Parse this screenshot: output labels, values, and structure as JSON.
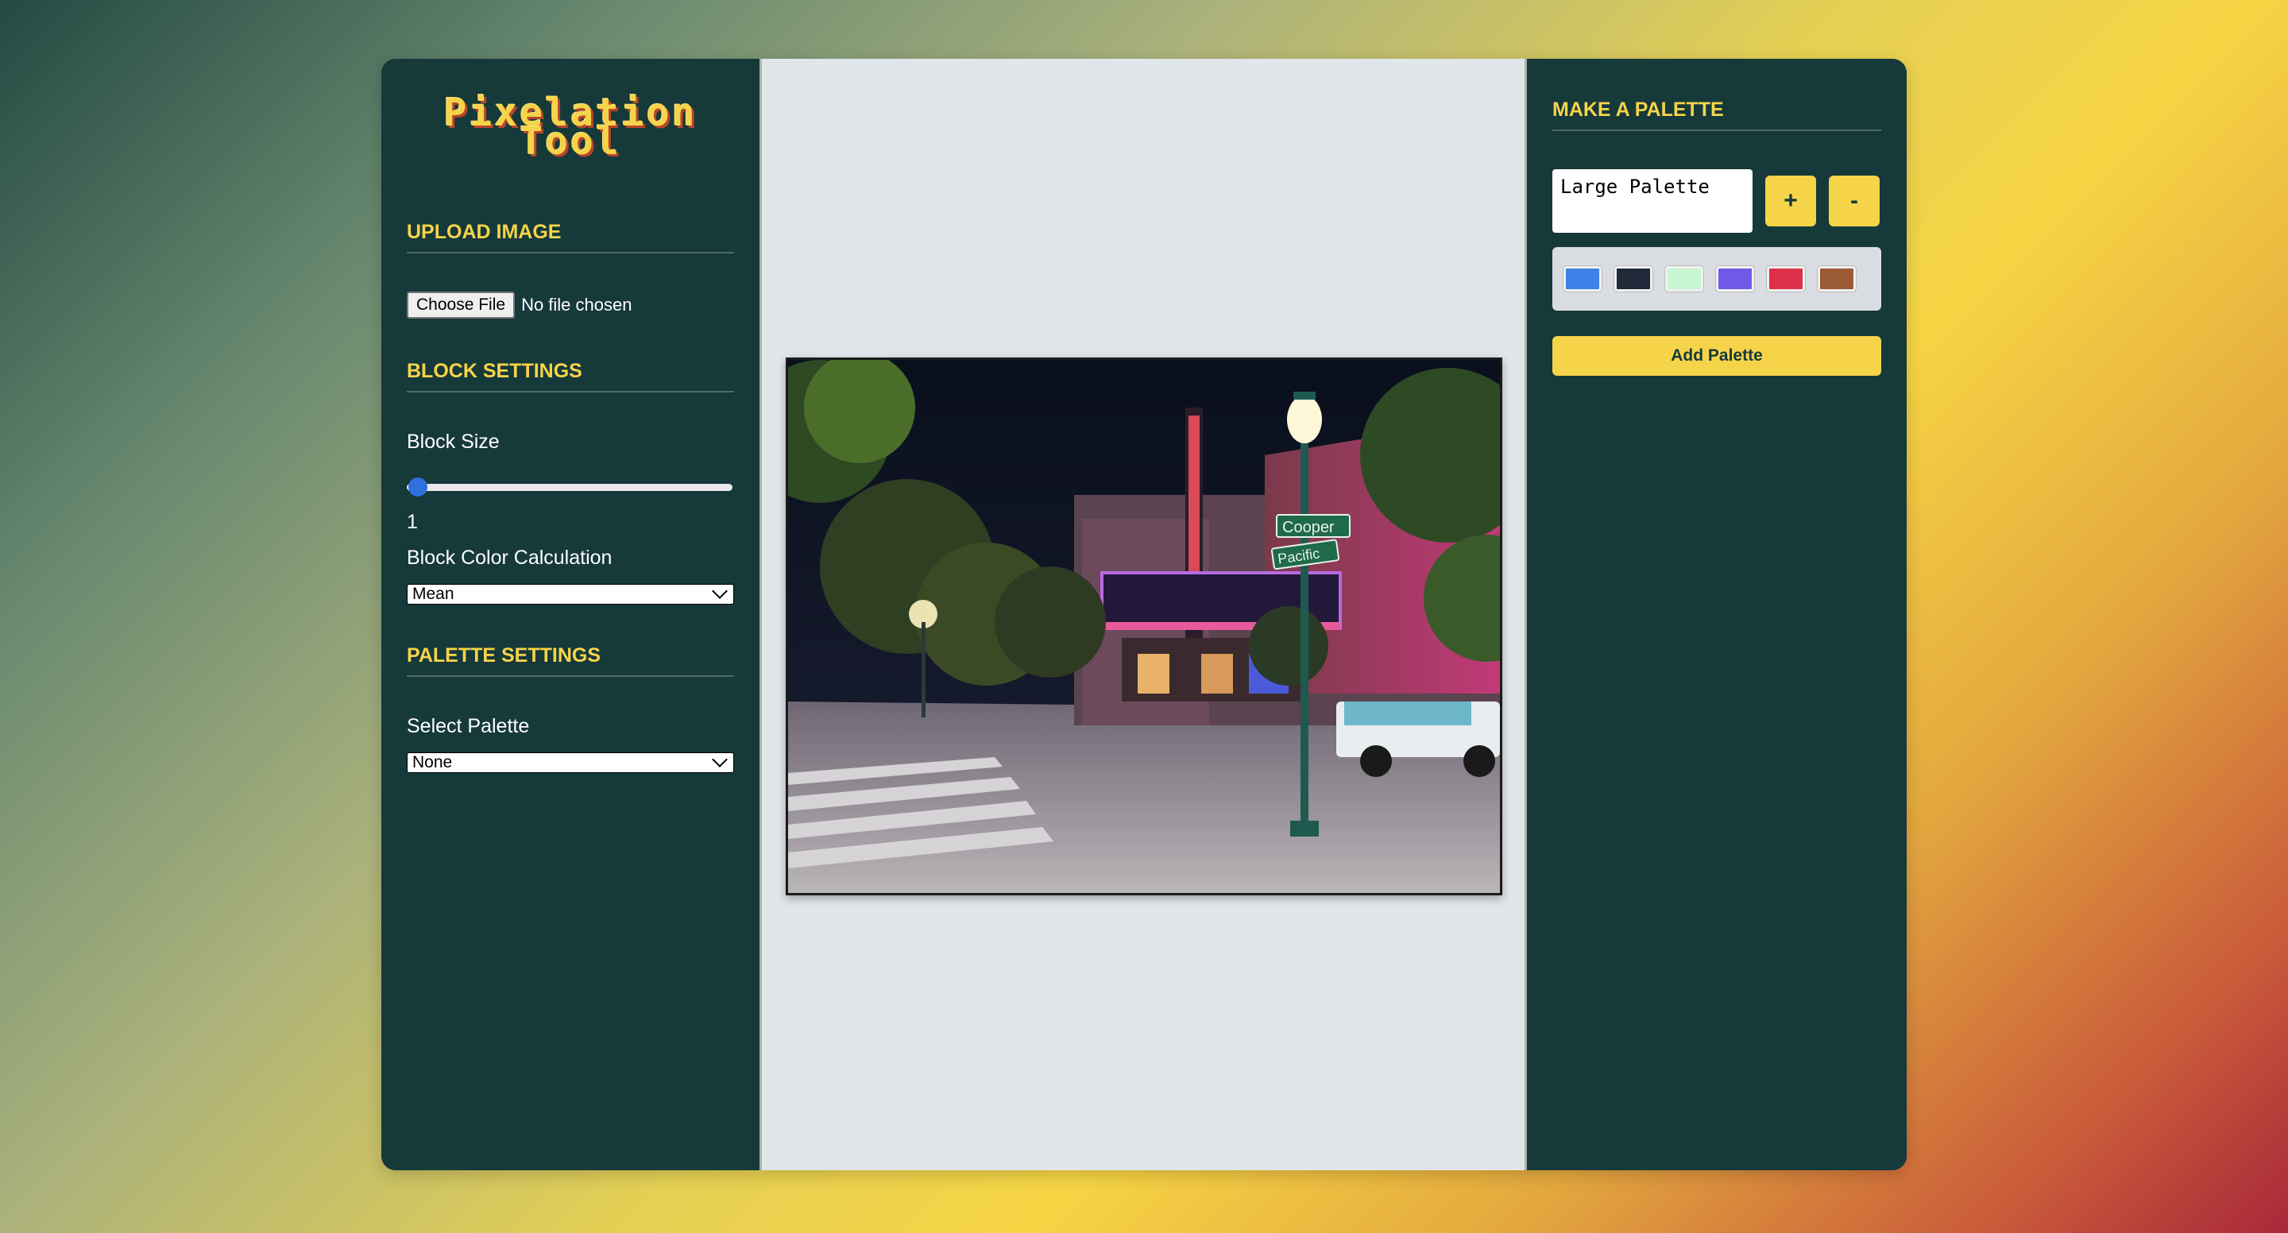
{
  "app": {
    "title_line1": "Pixelation",
    "title_line2": "Tool"
  },
  "upload": {
    "heading": "UPLOAD IMAGE",
    "button_label": "Choose File",
    "file_status": "No file chosen"
  },
  "block": {
    "heading": "BLOCK SETTINGS",
    "size_label": "Block Size",
    "size_value": "1",
    "color_calc_label": "Block Color Calculation",
    "color_calc_selected": "Mean"
  },
  "palette_settings": {
    "heading": "PALETTE SETTINGS",
    "select_label": "Select Palette",
    "selected": "None"
  },
  "make_palette": {
    "heading": "MAKE A PALETTE",
    "name_value": "Large Palette",
    "plus_label": "+",
    "minus_label": "-",
    "swatches": [
      "#3d82e8",
      "#22293a",
      "#c8f6d2",
      "#6f5be8",
      "#dc3148",
      "#9a5a34"
    ],
    "add_label": "Add Palette"
  },
  "preview": {
    "sign_cooper": "Cooper",
    "sign_pacific": "Pacific"
  },
  "colors": {
    "panel": "#16393a",
    "accent": "#f6d449",
    "canvas_bg": "#e1e6ea"
  }
}
